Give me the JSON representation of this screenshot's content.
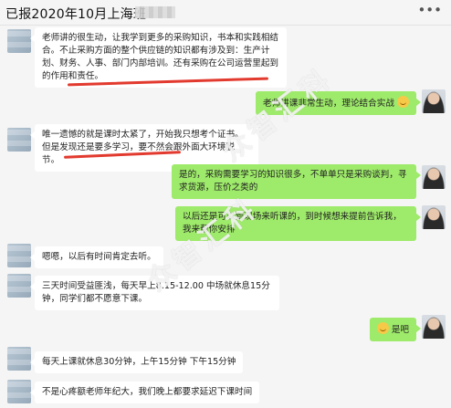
{
  "header": {
    "title": "已报2020年10月上海班",
    "menu_icon": "more-dots-icon"
  },
  "watermark": {
    "text": "众智汇科"
  },
  "colors": {
    "sent_bubble": "#9eea6a",
    "received_bubble": "#ffffff",
    "highlight_line": "#e23a2e"
  },
  "messages": [
    {
      "side": "left",
      "text": "老师讲的很生动，让我学到更多的采购知识，书本和实践相结合。不止采购方面的整个供应链的知识都有涉及到：生产计划、财务、人事、部门内部培训。还有采购在公司运营里起到的作用和责任。"
    },
    {
      "side": "right",
      "text": "老师讲课非常生动，理论结合实战",
      "emoji": "smile-emoji"
    },
    {
      "side": "left",
      "text": "唯一遗憾的就是课时太紧了，开始我只想考个证书。但是发现还是要多学习，要不然会跟外面大环境脱节。"
    },
    {
      "side": "right",
      "text": "是的，采购需要学习的知识很多，不单单只是采购谈判，寻求货源，压价之类的"
    },
    {
      "side": "right",
      "text": "以后还是可以到现场来听课的，到时候想来提前告诉我，我来帮你安排"
    },
    {
      "side": "left",
      "text": "嗯嗯，以后有时间肯定去听。"
    },
    {
      "side": "left",
      "text": "三天时间受益匪浅，每天早上8.15-12.00 中场就休息15分钟，同学们都不愿意下课。"
    },
    {
      "side": "right",
      "text": "是吧",
      "emoji": "smile-emoji"
    },
    {
      "side": "left",
      "text": "每天上课就休息30分钟，上午15分钟 下午15分钟"
    },
    {
      "side": "left",
      "text": "不是心疼额老师年纪大，我们晚上都要求延迟下课时间"
    }
  ]
}
